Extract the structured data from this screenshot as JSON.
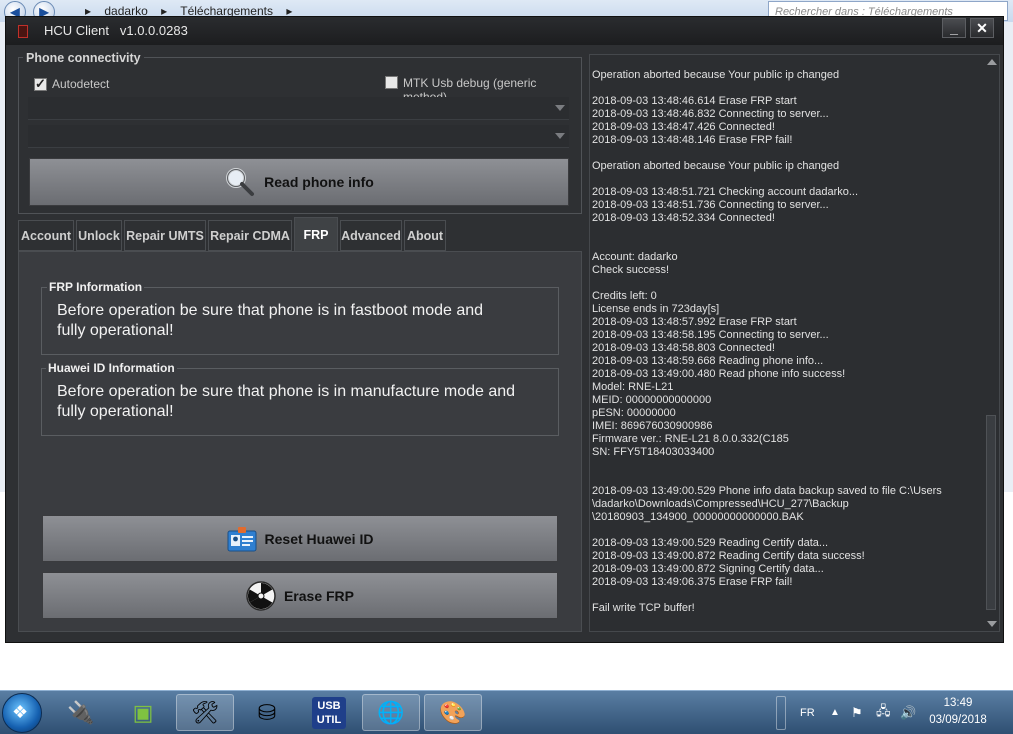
{
  "explorer": {
    "breadcrumbs": [
      "dadarko",
      "Téléchargements"
    ],
    "search_placeholder": "Rechercher dans : Téléchargements"
  },
  "window": {
    "title": "HCU Client",
    "version": "v1.0.0.0283",
    "minimize_label": "_",
    "close_label": "✕"
  },
  "connectivity": {
    "group_label": "Phone connectivity",
    "autodetect_label": "Autodetect",
    "autodetect_checked": true,
    "mtk_label": "MTK Usb debug (generic method)",
    "mtk_checked": false,
    "port_value": "",
    "device_value": "",
    "read_button_label": "Read phone info"
  },
  "tabs": [
    {
      "label": "Account"
    },
    {
      "label": "Unlock"
    },
    {
      "label": "Repair UMTS"
    },
    {
      "label": "Repair CDMA"
    },
    {
      "label": "FRP",
      "active": true
    },
    {
      "label": "Advanced"
    },
    {
      "label": "About"
    }
  ],
  "frp": {
    "frp_title": "FRP Information",
    "frp_text_line1": "Before operation be sure that phone is in fastboot mode and",
    "frp_text_line2": "fully operational!",
    "hid_title": "Huawei ID Information",
    "hid_text_line1": "Before operation be sure that phone is in manufacture mode and",
    "hid_text_line2": "fully operational!",
    "reset_button_label": "Reset Huawei ID",
    "erase_button_label": "Erase FRP"
  },
  "log": {
    "lines": [
      "Operation aborted because Your public ip changed",
      "",
      "2018-09-03 13:48:46.614 Erase FRP start",
      "2018-09-03 13:48:46.832 Connecting to server...",
      "2018-09-03 13:48:47.426 Connected!",
      "2018-09-03 13:48:48.146 Erase FRP fail!",
      "",
      "Operation aborted because Your public ip changed",
      "",
      "2018-09-03 13:48:51.721 Checking account dadarko...",
      "2018-09-03 13:48:51.736 Connecting to server...",
      "2018-09-03 13:48:52.334 Connected!",
      "",
      "",
      "Account: dadarko",
      "Check success!",
      "",
      "Credits left: 0",
      "License ends in 723day[s]",
      "2018-09-03 13:48:57.992 Erase FRP start",
      "2018-09-03 13:48:58.195 Connecting to server...",
      "2018-09-03 13:48:58.803 Connected!",
      "2018-09-03 13:48:59.668 Reading phone info...",
      "2018-09-03 13:49:00.480 Read phone info success!",
      "Model: RNE-L21",
      "MEID: 00000000000000",
      "pESN: 00000000",
      "IMEI: 869676030900986",
      "Firmware ver.: RNE-L21 8.0.0.332(C185",
      "SN: FFY5T18403033400",
      "",
      "",
      "2018-09-03 13:49:00.529 Phone info data backup saved to file C:\\Users",
      "\\dadarko\\Downloads\\Compressed\\HCU_277\\Backup",
      "\\20180903_134900_00000000000000.BAK",
      "",
      "2018-09-03 13:49:00.529 Reading Certify data...",
      "2018-09-03 13:49:00.872 Reading Certify data success!",
      "2018-09-03 13:49:00.872 Signing Certify data...",
      "2018-09-03 13:49:06.375 Erase FRP fail!",
      "",
      "Fail write TCP buffer!"
    ]
  },
  "taskbar": {
    "language": "FR",
    "time": "13:49",
    "date": "03/09/2018",
    "usb_util_line1": "USB",
    "usb_util_line2": "UTIL"
  },
  "colors": {
    "window_bg": "#2e3033",
    "button_gray": "#7c7e83",
    "log_text": "#e2e2e2"
  }
}
